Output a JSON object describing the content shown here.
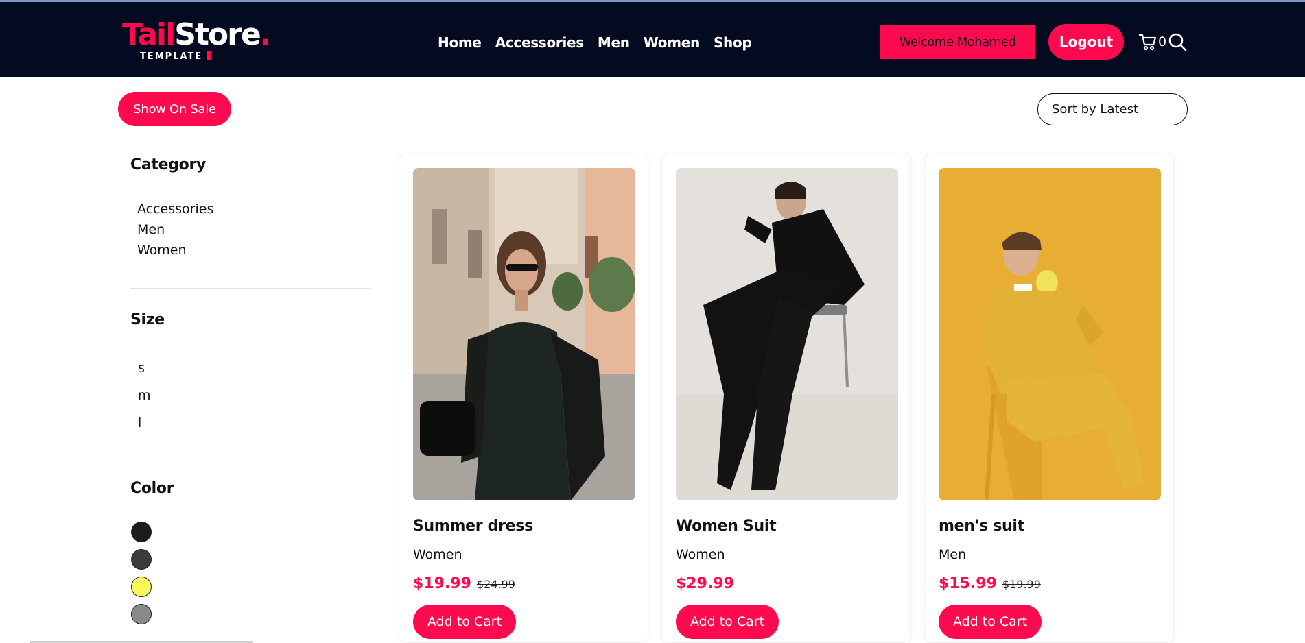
{
  "header": {
    "logo": {
      "brand_main": "Tail",
      "brand_second": "Store",
      "brand_dot": ".",
      "subtitle": "TEMPLATE"
    },
    "nav": [
      {
        "label": "Home"
      },
      {
        "label": "Accessories"
      },
      {
        "label": "Men"
      },
      {
        "label": "Women"
      },
      {
        "label": "Shop"
      }
    ],
    "welcome_label": "Welcome Mohamed",
    "logout_label": "Logout",
    "cart_count": "0",
    "icons": {
      "cart": "cart-icon",
      "search": "search-icon"
    }
  },
  "toolbar": {
    "sale_label": "Show On Sale",
    "sort_label": "Sort by Latest"
  },
  "sidebar": {
    "category_heading": "Category",
    "categories": [
      "Accessories",
      "Men",
      "Women"
    ],
    "size_heading": "Size",
    "sizes": [
      "s",
      "m",
      "l"
    ],
    "color_heading": "Color",
    "colors": [
      "#1c1c1c",
      "#3b3b3b",
      "#f7f75a",
      "#8a8a8a"
    ]
  },
  "products": [
    {
      "title": "Summer dress",
      "category": "Women",
      "price": "$19.99",
      "old_price": "$24.99",
      "button": "Add to Cart"
    },
    {
      "title": "Women Suit",
      "category": "Women",
      "price": "$29.99",
      "old_price": "",
      "button": "Add to Cart"
    },
    {
      "title": "men's suit",
      "category": "Men",
      "price": "$15.99",
      "old_price": "$19.99",
      "button": "Add to Cart"
    }
  ],
  "colors": {
    "accent": "#ff0a4e",
    "header_bg": "#040a1f"
  }
}
